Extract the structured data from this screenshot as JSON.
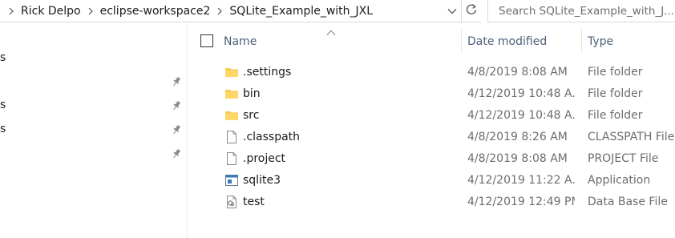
{
  "breadcrumb": {
    "items": [
      "Rick Delpo",
      "eclipse-workspace2",
      "SQLite_Example_with_JXL"
    ]
  },
  "search": {
    "placeholder": "Search SQLite_Example_with_J..."
  },
  "nav": {
    "items": [
      {
        "label": "s",
        "pinned": false
      },
      {
        "label": "",
        "pinned": true
      },
      {
        "label": "s",
        "pinned": true
      },
      {
        "label": "s",
        "pinned": true
      },
      {
        "label": "",
        "pinned": true
      }
    ]
  },
  "columns": {
    "name": "Name",
    "date": "Date modified",
    "type": "Type"
  },
  "files": [
    {
      "name": ".settings",
      "date": "4/8/2019 8:08 AM",
      "type": "File folder",
      "icon": "folder-icon"
    },
    {
      "name": "bin",
      "date": "4/12/2019 10:48 A...",
      "type": "File folder",
      "icon": "folder-icon"
    },
    {
      "name": "src",
      "date": "4/12/2019 10:48 A...",
      "type": "File folder",
      "icon": "folder-icon"
    },
    {
      "name": ".classpath",
      "date": "4/8/2019 8:26 AM",
      "type": "CLASSPATH File",
      "icon": "file-icon"
    },
    {
      "name": ".project",
      "date": "4/8/2019 8:08 AM",
      "type": "PROJECT File",
      "icon": "file-icon"
    },
    {
      "name": "sqlite3",
      "date": "4/12/2019 11:22 A...",
      "type": "Application",
      "icon": "application-icon"
    },
    {
      "name": "test",
      "date": "4/12/2019 12:49 PM",
      "type": "Data Base File",
      "icon": "database-file-icon"
    }
  ],
  "colors": {
    "header_text": "#4c607a",
    "folder": "#f6c94a",
    "secondary_text": "#6d6d6d"
  }
}
